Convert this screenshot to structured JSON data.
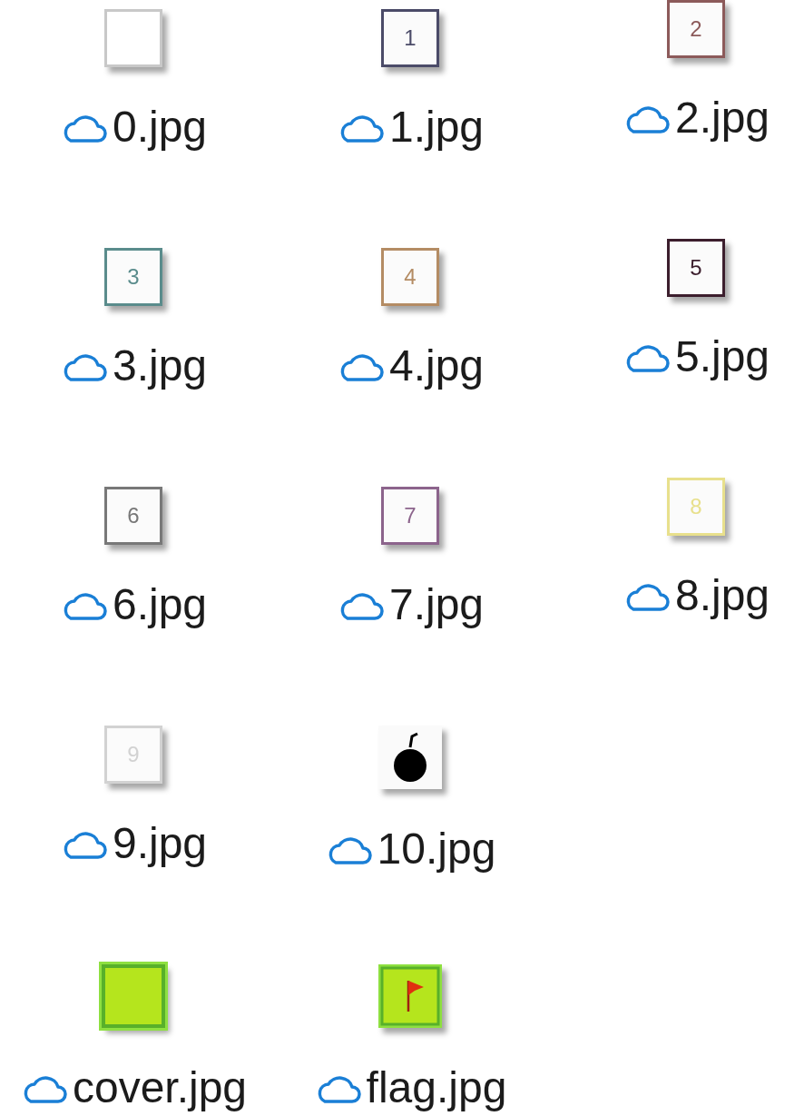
{
  "rows": [
    {
      "files": [
        {
          "kind": "blank",
          "color": "#c8c8c8",
          "label": "0.jpg"
        },
        {
          "kind": "digit",
          "color": "#4b4b68",
          "thumb_text": "1",
          "label": "1.jpg"
        },
        {
          "kind": "digit",
          "color": "#8c5a5a",
          "thumb_text": "2",
          "label": "2.jpg"
        }
      ]
    },
    {
      "files": [
        {
          "kind": "digit",
          "color": "#5a8c8c",
          "thumb_text": "3",
          "label": "3.jpg"
        },
        {
          "kind": "digit",
          "color": "#b48c64",
          "thumb_text": "4",
          "label": "4.jpg"
        },
        {
          "kind": "digit",
          "color": "#3c1e2d",
          "thumb_text": "5",
          "label": "5.jpg"
        }
      ]
    },
    {
      "files": [
        {
          "kind": "digit",
          "color": "#787878",
          "thumb_text": "6",
          "label": "6.jpg"
        },
        {
          "kind": "digit",
          "color": "#8c648c",
          "thumb_text": "7",
          "label": "7.jpg"
        },
        {
          "kind": "digit",
          "color": "#e8e08c",
          "thumb_text": "8",
          "label": "8.jpg"
        }
      ]
    },
    {
      "files": [
        {
          "kind": "digit",
          "color": "#d2d2d2",
          "thumb_text": "9",
          "label": "9.jpg"
        },
        {
          "kind": "bomb",
          "label": "10.jpg"
        }
      ]
    },
    {
      "files": [
        {
          "kind": "cover",
          "label": "cover.jpg"
        },
        {
          "kind": "flag",
          "label": "flag.jpg"
        }
      ]
    }
  ]
}
